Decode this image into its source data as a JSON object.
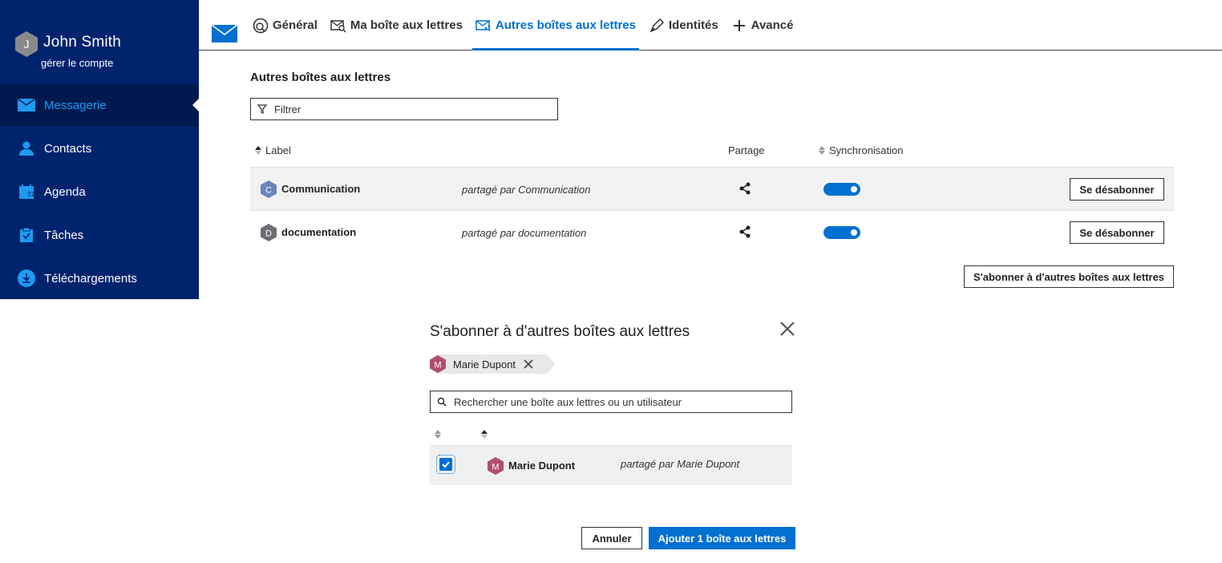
{
  "user": {
    "initial": "J",
    "name": "John Smith",
    "manage_label": "gérer le compte"
  },
  "sidebar": {
    "items": [
      {
        "label": "Messagerie",
        "icon": "mail-icon",
        "active": true
      },
      {
        "label": "Contacts",
        "icon": "person-icon"
      },
      {
        "label": "Agenda",
        "icon": "calendar-icon"
      },
      {
        "label": "Tâches",
        "icon": "clipboard-icon"
      },
      {
        "label": "Téléchargements",
        "icon": "download-icon"
      }
    ]
  },
  "tabs": [
    {
      "label": "Général",
      "icon": "globe-icon"
    },
    {
      "label": "Ma boîte aux lettres",
      "icon": "mailbox-search-icon"
    },
    {
      "label": "Autres boîtes aux lettres",
      "icon": "mail-shared-icon",
      "active": true
    },
    {
      "label": "Identités",
      "icon": "pen-icon"
    },
    {
      "label": "Avancé",
      "icon": "plus-icon"
    }
  ],
  "main": {
    "title": "Autres boîtes aux lettres",
    "filter_placeholder": "Filtrer",
    "columns": {
      "label": "Label",
      "sharing": "Partage",
      "sync": "Synchronisation"
    },
    "rows": [
      {
        "initial": "C",
        "label": "Communication",
        "shared_by": "partagé par Communication",
        "sync": true,
        "action": "Se désabonner",
        "color": "#6a86b8"
      },
      {
        "initial": "D",
        "label": "documentation",
        "shared_by": "partagé par documentation",
        "sync": true,
        "action": "Se désabonner",
        "color": "#6b6f75"
      }
    ],
    "subscribe_button": "S'abonner à d'autres boîtes aux lettres"
  },
  "modal": {
    "title": "S'abonner à d'autres boîtes aux lettres",
    "chip": {
      "initial": "M",
      "label": "Marie Dupont"
    },
    "search_placeholder": "Rechercher une boîte aux lettres ou un utilisateur",
    "results": [
      {
        "initial": "M",
        "label": "Marie Dupont",
        "shared_by": "partagé par Marie Dupont",
        "checked": true,
        "color": "#b34d6d"
      }
    ],
    "cancel": "Annuler",
    "confirm": "Ajouter 1 boîte aux lettres"
  },
  "colors": {
    "sidebar": "#00236e",
    "accent": "#0070d1",
    "active_nav_text": "#1e9bf0"
  }
}
